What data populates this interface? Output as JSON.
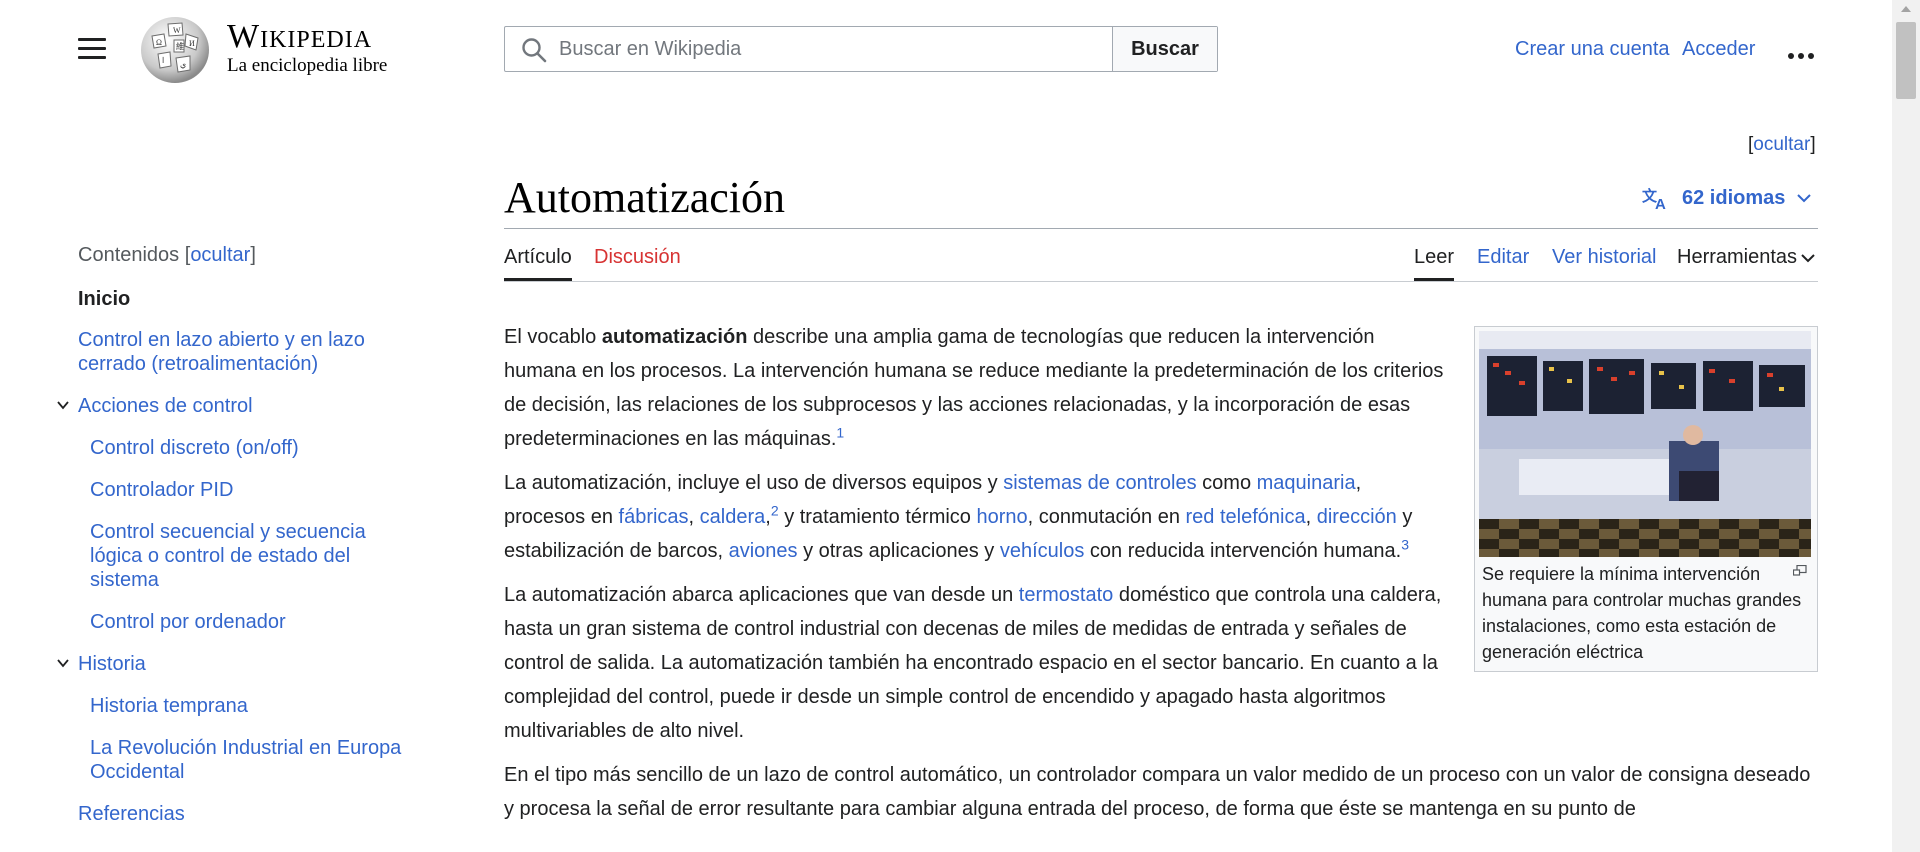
{
  "header": {
    "wordmark": "Wikipedia",
    "tagline": "La enciclopedia libre",
    "search_placeholder": "Buscar en Wikipedia",
    "search_button": "Buscar",
    "create_account": "Crear una cuenta",
    "login": "Acceder"
  },
  "hide_top": {
    "open": "[",
    "label": "ocultar",
    "close": "]"
  },
  "page": {
    "title": "Automatización",
    "languages": "62 idiomas"
  },
  "tabs": {
    "article": "Artículo",
    "talk": "Discusión",
    "read": "Leer",
    "edit": "Editar",
    "history": "Ver historial",
    "tools": "Herramientas"
  },
  "toc": {
    "heading": "Contenidos",
    "hide_open": " [",
    "hide": "ocultar",
    "hide_close": "]",
    "items": [
      {
        "label": "Inicio"
      },
      {
        "label": "Control en lazo abierto y en lazo cerrado (retroalimentación)"
      },
      {
        "label": "Acciones de control"
      },
      {
        "label": "Control discreto (on/off)"
      },
      {
        "label": "Controlador PID"
      },
      {
        "label": "Control secuencial y secuencia lógica o control de estado del sistema"
      },
      {
        "label": "Control por ordenador"
      },
      {
        "label": "Historia"
      },
      {
        "label": "Historia temprana"
      },
      {
        "label": "La Revolución Industrial en Europa Occidental"
      },
      {
        "label": "Referencias"
      }
    ]
  },
  "figure": {
    "caption": "Se requiere la mínima intervención humana para controlar muchas grandes instalaciones, como esta estación de generación eléctrica"
  },
  "article": {
    "p1": {
      "t1": "El vocablo ",
      "b1": "automatización",
      "t2": " describe una amplia gama de tecnologías que reducen la intervención humana en los procesos. La intervención humana se reduce mediante la predeterminación de los criterios de decisión, las relaciones de los subprocesos y las acciones relacionadas, y la incorporación de esas predeterminaciones en las máquinas.",
      "ref1": "1"
    },
    "p2": {
      "t1": "La automatización, incluye el uso de diversos equipos y ",
      "l1": "sistemas de controles",
      "t2": " como ",
      "l2": "maquinaria",
      "t3": ", procesos en ",
      "l3": "fábricas",
      "t4": ", ",
      "l4": "caldera",
      "t5": ",",
      "ref2": "2",
      "t6": "  y tratamiento térmico ",
      "l5": "horno",
      "t7": ", conmutación en ",
      "l6": "red telefónica",
      "t8": ", ",
      "l7": "dirección",
      "t9": " y estabilización de barcos, ",
      "l8": "aviones",
      "t10": " y otras aplicaciones y ",
      "l9": "vehículos",
      "t11": " con reducida intervención humana.",
      "ref3": "3"
    },
    "p3": {
      "t1": "La automatización abarca aplicaciones que van desde un ",
      "l1": "termostato",
      "t2": " doméstico que controla una caldera, hasta un gran sistema de control industrial con decenas de miles de medidas de entrada y señales de control de salida. La automatización también ha encontrado espacio en el sector bancario. En cuanto a la complejidad del control, puede ir desde un simple control de encendido y apagado hasta algoritmos multivariables de alto nivel."
    },
    "p4": {
      "t1": "En el tipo más sencillo de un lazo de control automático, un controlador compara un valor medido de un proceso con un valor de consigna deseado y procesa la señal de error resultante para cambiar alguna entrada del proceso, de forma que éste se mantenga en su punto de"
    }
  },
  "colors": {
    "link": "#3366cc",
    "link_red": "#d73333",
    "text": "#202122",
    "border": "#a2a9b1"
  }
}
